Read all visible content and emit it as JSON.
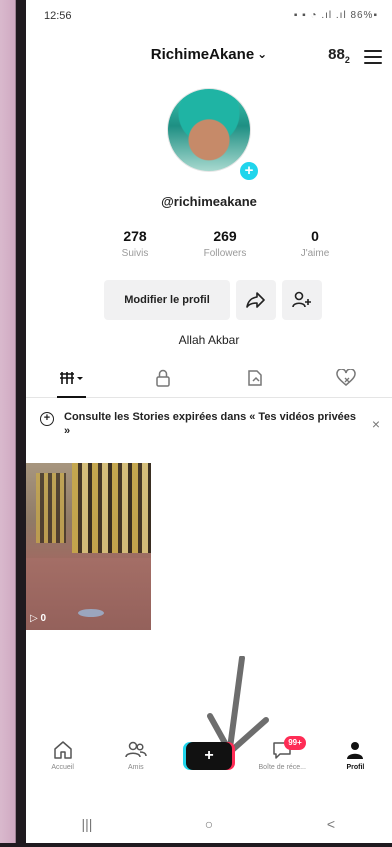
{
  "status_bar": {
    "time": "12:56",
    "icons_text": "▪ ▪ ◔ .ıl .ıl 86%▪"
  },
  "header": {
    "username": "RichimeAkane",
    "username_chevron": "⌄",
    "add_icon_glyph": "8",
    "add_icon_sub": "2"
  },
  "profile": {
    "handle": "@richimeakane",
    "avatar_plus": "+",
    "stats": [
      {
        "value": "278",
        "label": "Suivis"
      },
      {
        "value": "269",
        "label": "Followers"
      },
      {
        "value": "0",
        "label": "J'aime"
      }
    ],
    "edit_button": "Modifier le profil",
    "bio": "Allah Akbar"
  },
  "tabs": [
    {
      "name": "videos-grid",
      "icon": "grid-icon"
    },
    {
      "name": "private",
      "icon": "lock-icon"
    },
    {
      "name": "reposts",
      "icon": "repost-icon"
    },
    {
      "name": "liked",
      "icon": "heart-hidden-icon"
    }
  ],
  "notice": {
    "text": "Consulte les Stories expirées dans « Tes vidéos privées »",
    "close": "×"
  },
  "video": {
    "views": "▷ 0"
  },
  "bottom_nav": {
    "items": [
      {
        "label": "Accueil",
        "icon": "home-icon"
      },
      {
        "label": "Amis",
        "icon": "friends-icon"
      },
      {
        "label": "",
        "icon": "create-icon"
      },
      {
        "label": "Boîte de réce...",
        "icon": "inbox-icon",
        "badge": "99+"
      },
      {
        "label": "Profil",
        "icon": "profile-icon"
      }
    ]
  },
  "android_nav": {
    "recents": "|||",
    "home": "○",
    "back": "<"
  },
  "colors": {
    "accent_cyan": "#20d5ec",
    "accent_red": "#fe2c55",
    "text": "#111111",
    "muted": "#9a9a9a"
  }
}
